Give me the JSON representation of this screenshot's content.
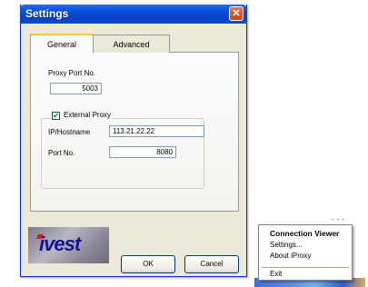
{
  "window": {
    "title": "Settings",
    "close_glyph": "✕"
  },
  "tabs": [
    {
      "label": "General",
      "selected": true
    },
    {
      "label": "Advanced",
      "selected": false
    }
  ],
  "general": {
    "proxy_port_label": "Proxy Port No.",
    "proxy_port_value": "5003",
    "external_proxy_label": "External Proxy",
    "external_proxy_checked": true,
    "checkmark": "✔",
    "hostname_label": "IP/Hostname",
    "hostname_value": "113.21.22.22",
    "port_label": "Port No.",
    "port_value": "8080"
  },
  "buttons": {
    "ok": "OK",
    "cancel": "Cancel"
  },
  "logo": {
    "text": "ivest"
  },
  "tray_menu": {
    "items": [
      {
        "label": "Connection Viewer",
        "bold": true
      },
      {
        "label": "Settings...",
        "bold": false
      },
      {
        "label": "About iProxy",
        "bold": false
      },
      {
        "label": "Exit",
        "bold": false
      }
    ]
  },
  "colors": {
    "titlebar": "#0a4fd8",
    "close_button": "#c9421c",
    "dialog_face": "#ece9d8",
    "tab_highlight": "#ffc83c",
    "logo_text": "#14148c"
  }
}
